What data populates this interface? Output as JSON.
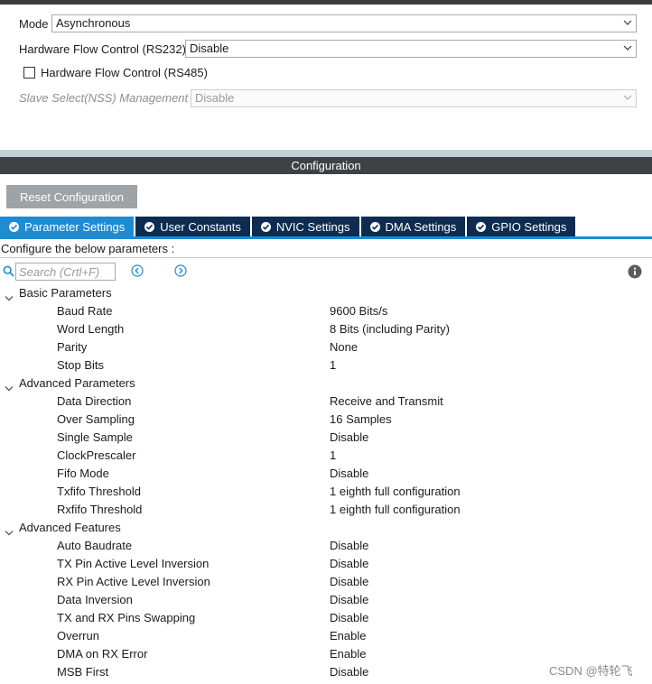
{
  "mode": {
    "label": "Mode",
    "value": "Asynchronous"
  },
  "hw_flow_rs232": {
    "label": "Hardware Flow Control (RS232)",
    "value": "Disable"
  },
  "hw_flow_rs485": {
    "label": "Hardware Flow Control (RS485)",
    "checked": false
  },
  "slave_select": {
    "label": "Slave Select(NSS) Management",
    "value": "Disable"
  },
  "config_header": "Configuration",
  "reset_button": "Reset Configuration",
  "tabs": [
    {
      "label": "Parameter Settings",
      "active": true
    },
    {
      "label": "User Constants",
      "active": false
    },
    {
      "label": "NVIC Settings",
      "active": false
    },
    {
      "label": "DMA Settings",
      "active": false
    },
    {
      "label": "GPIO Settings",
      "active": false
    }
  ],
  "configure_text": "Configure the below parameters :",
  "search": {
    "placeholder": "Search (Crtl+F)"
  },
  "groups": [
    {
      "name": "Basic Parameters",
      "params": [
        {
          "name": "Baud Rate",
          "value": "9600 Bits/s"
        },
        {
          "name": "Word Length",
          "value": "8 Bits (including Parity)"
        },
        {
          "name": "Parity",
          "value": "None"
        },
        {
          "name": "Stop Bits",
          "value": "1"
        }
      ]
    },
    {
      "name": "Advanced Parameters",
      "params": [
        {
          "name": "Data Direction",
          "value": "Receive and Transmit"
        },
        {
          "name": "Over Sampling",
          "value": "16 Samples"
        },
        {
          "name": "Single Sample",
          "value": "Disable"
        },
        {
          "name": "ClockPrescaler",
          "value": "1"
        },
        {
          "name": "Fifo Mode",
          "value": "Disable"
        },
        {
          "name": "Txfifo Threshold",
          "value": "1 eighth full configuration"
        },
        {
          "name": "Rxfifo Threshold",
          "value": "1 eighth full configuration"
        }
      ]
    },
    {
      "name": "Advanced Features",
      "params": [
        {
          "name": "Auto Baudrate",
          "value": "Disable"
        },
        {
          "name": "TX Pin Active Level Inversion",
          "value": "Disable"
        },
        {
          "name": "RX Pin Active Level Inversion",
          "value": "Disable"
        },
        {
          "name": "Data Inversion",
          "value": "Disable"
        },
        {
          "name": "TX and RX Pins Swapping",
          "value": "Disable"
        },
        {
          "name": "Overrun",
          "value": "Enable"
        },
        {
          "name": "DMA on RX Error",
          "value": "Enable"
        },
        {
          "name": "MSB First",
          "value": "Disable"
        }
      ]
    }
  ],
  "watermark": "CSDN @特轮飞",
  "colors": {
    "active_tab": "#1f8bd2",
    "tab": "#0d2c4f",
    "header": "#3d4246",
    "reset_button": "#9ea3a7"
  }
}
